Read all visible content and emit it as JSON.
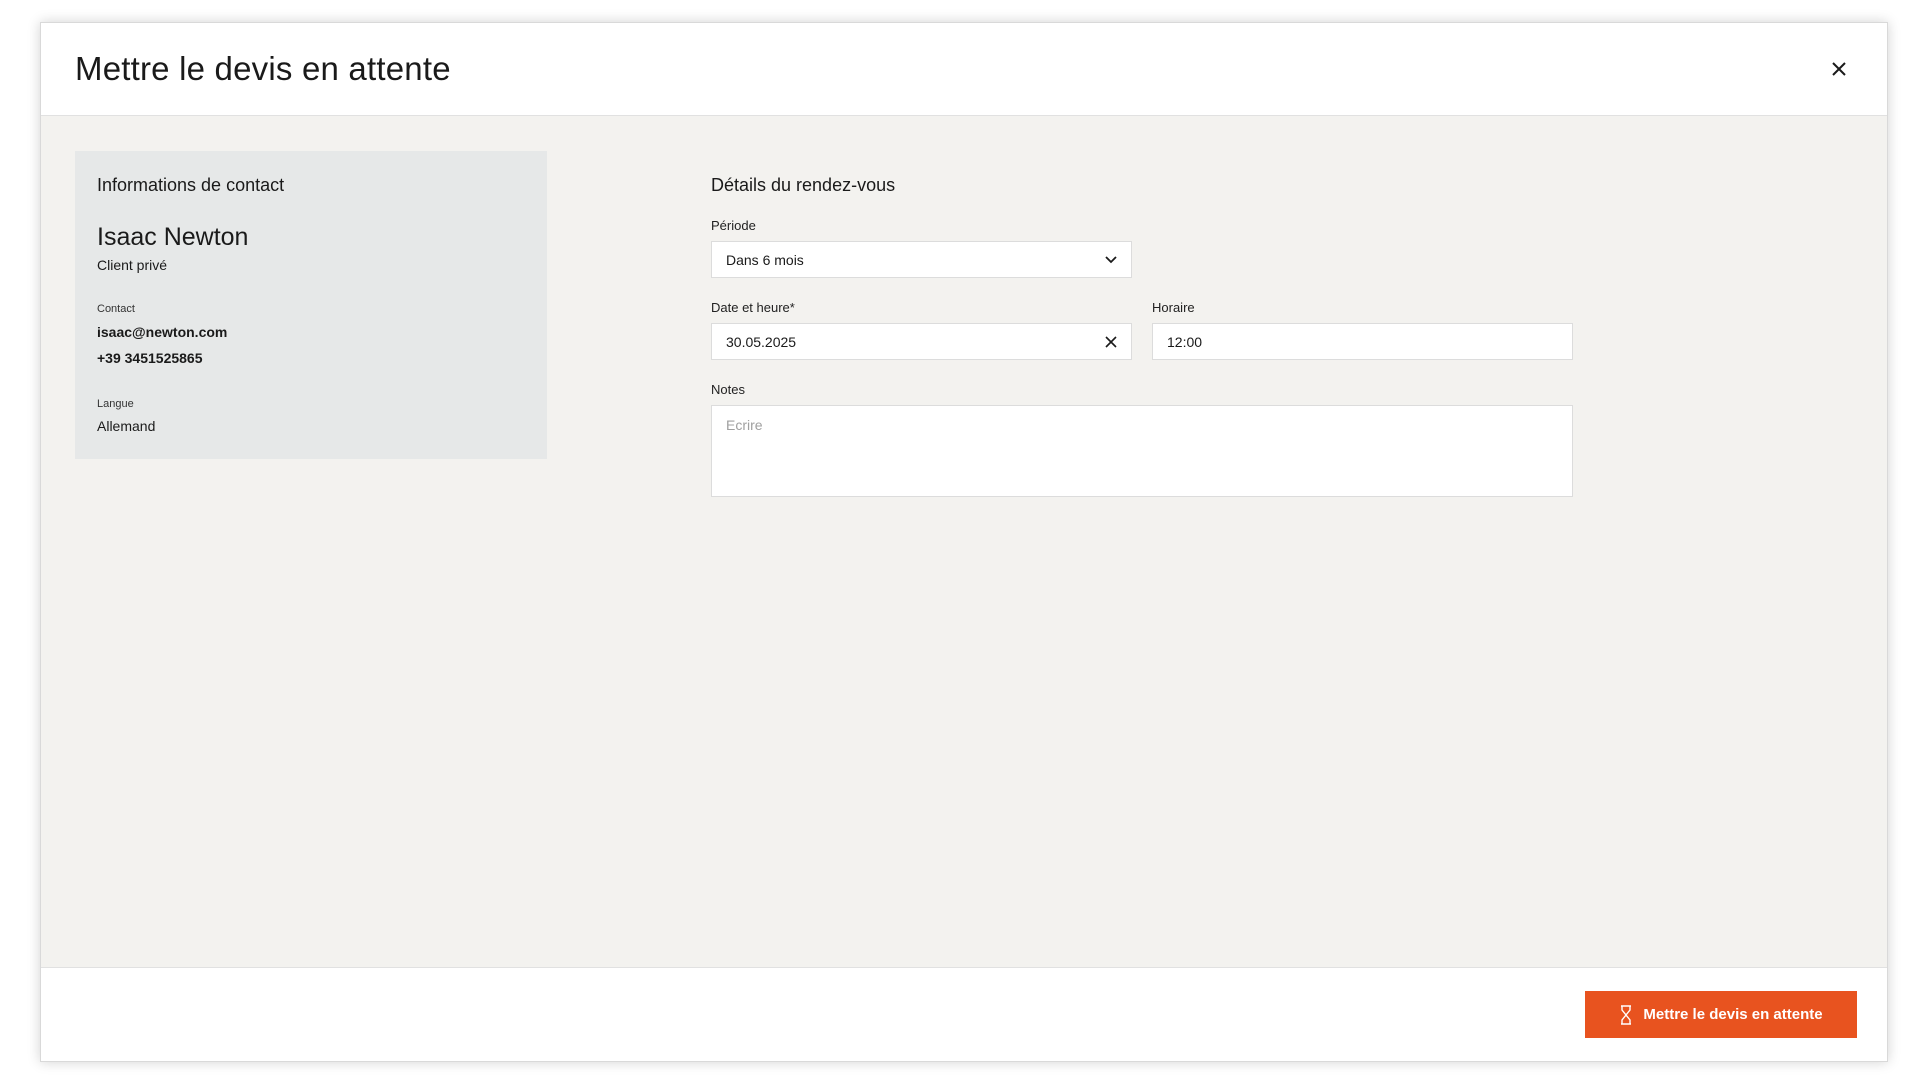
{
  "dialog": {
    "title": "Mettre le devis en attente"
  },
  "contact": {
    "heading": "Informations de contact",
    "name": "Isaac Newton",
    "type": "Client privé",
    "contact_label": "Contact",
    "email": "isaac@newton.com",
    "phone": "+39 3451525865",
    "language_label": "Langue",
    "language": "Allemand"
  },
  "appointment": {
    "heading": "Détails du rendez-vous",
    "period_label": "Période",
    "period_value": "Dans 6 mois",
    "date_label": "Date et heure*",
    "date_value": "30.05.2025",
    "time_label": "Horaire",
    "time_value": "12:00",
    "notes_label": "Notes",
    "notes_placeholder": "Ecrire"
  },
  "footer": {
    "submit_label": "Mettre le devis en attente"
  },
  "colors": {
    "accent": "#e8531f",
    "body_bg": "#f3f2ef",
    "card_bg": "#e6e8e8"
  },
  "icons": {
    "close": "close-icon",
    "dropdown": "chevron-down-icon",
    "clear": "clear-icon",
    "submit": "hourglass-icon"
  }
}
